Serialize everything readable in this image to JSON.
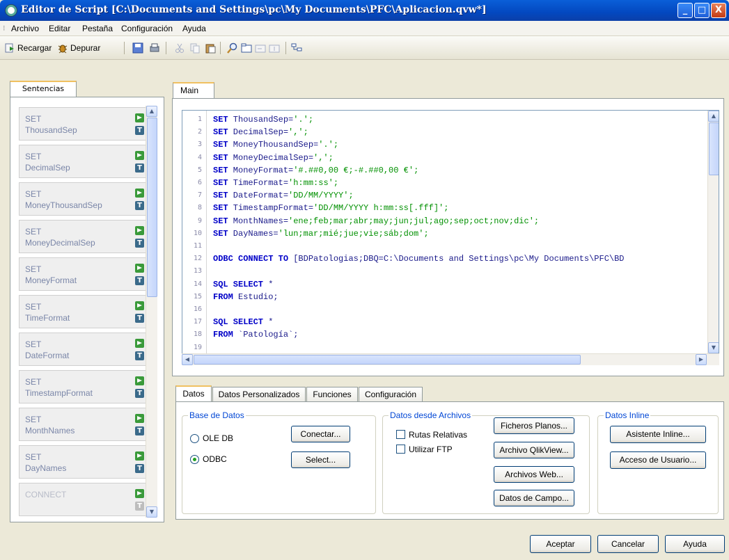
{
  "window": {
    "title": "Editor de Script [C:\\Documents and Settings\\pc\\My Documents\\PFC\\Aplicacion.qvw*]",
    "minimize": "_",
    "maximize": "□",
    "close": "X"
  },
  "menu": {
    "items": [
      {
        "label": "Archivo"
      },
      {
        "label": "Editar"
      },
      {
        "label": "Pestaña"
      },
      {
        "label": "Configuración"
      },
      {
        "label": "Ayuda"
      }
    ]
  },
  "toolbar": {
    "reload_label": "Recargar",
    "debug_label": "Depurar",
    "icons": [
      "reload-icon",
      "debug-icon",
      "save-icon",
      "print-icon",
      "cut-icon",
      "copy-icon",
      "paste-icon",
      "find-icon",
      "new-tab-icon",
      "insert-tab-icon",
      "promote-tab-icon",
      "script-icon"
    ]
  },
  "statements_panel": {
    "tab_label": "Sentencias",
    "items": [
      {
        "keyword": "SET",
        "name": "ThousandSep",
        "enabled": true
      },
      {
        "keyword": "SET",
        "name": "DecimalSep",
        "enabled": true
      },
      {
        "keyword": "SET",
        "name": "MoneyThousandSep",
        "enabled": true
      },
      {
        "keyword": "SET",
        "name": "MoneyDecimalSep",
        "enabled": true
      },
      {
        "keyword": "SET",
        "name": "MoneyFormat",
        "enabled": true
      },
      {
        "keyword": "SET",
        "name": "TimeFormat",
        "enabled": true
      },
      {
        "keyword": "SET",
        "name": "DateFormat",
        "enabled": true
      },
      {
        "keyword": "SET",
        "name": "TimestampFormat",
        "enabled": true
      },
      {
        "keyword": "SET",
        "name": "MonthNames",
        "enabled": true
      },
      {
        "keyword": "SET",
        "name": "DayNames",
        "enabled": true
      },
      {
        "keyword": "CONNECT",
        "name": "",
        "enabled": false
      }
    ],
    "t_glyph": "T"
  },
  "editor": {
    "tab_label": "Main",
    "lines": [
      {
        "n": "1",
        "kw": "SET",
        "rest": " ThousandSep=",
        "str": "'.';"
      },
      {
        "n": "2",
        "kw": "SET",
        "rest": " DecimalSep=",
        "str": "',';"
      },
      {
        "n": "3",
        "kw": "SET",
        "rest": " MoneyThousandSep=",
        "str": "'.';"
      },
      {
        "n": "4",
        "kw": "SET",
        "rest": " MoneyDecimalSep=",
        "str": "',';"
      },
      {
        "n": "5",
        "kw": "SET",
        "rest": " MoneyFormat=",
        "str": "'#.##0,00 €;-#.##0,00 €';"
      },
      {
        "n": "6",
        "kw": "SET",
        "rest": " TimeFormat=",
        "str": "'h:mm:ss';"
      },
      {
        "n": "7",
        "kw": "SET",
        "rest": " DateFormat=",
        "str": "'DD/MM/YYYY';"
      },
      {
        "n": "8",
        "kw": "SET",
        "rest": " TimestampFormat=",
        "str": "'DD/MM/YYYY h:mm:ss[.fff]';"
      },
      {
        "n": "9",
        "kw": "SET",
        "rest": " MonthNames=",
        "str": "'ene;feb;mar;abr;may;jun;jul;ago;sep;oct;nov;dic';"
      },
      {
        "n": "10",
        "kw": "SET",
        "rest": " DayNames=",
        "str": "'lun;mar;mié;jue;vie;sáb;dom';"
      },
      {
        "n": "11",
        "kw": "",
        "rest": "",
        "str": ""
      },
      {
        "n": "12",
        "kw": "ODBC CONNECT TO",
        "rest": " [BDPatologias;DBQ=C:\\Documents and Settings\\pc\\My Documents\\PFC\\BD",
        "str": ""
      },
      {
        "n": "13",
        "kw": "",
        "rest": "",
        "str": ""
      },
      {
        "n": "14",
        "kw": "SQL SELECT",
        "rest": " *",
        "str": ""
      },
      {
        "n": "15",
        "kw": "FROM",
        "rest": " Estudio;",
        "str": ""
      },
      {
        "n": "16",
        "kw": "",
        "rest": "",
        "str": ""
      },
      {
        "n": "17",
        "kw": "SQL SELECT",
        "rest": " *",
        "str": ""
      },
      {
        "n": "18",
        "kw": "FROM",
        "rest": " `Patología`;",
        "str": ""
      },
      {
        "n": "19",
        "kw": "",
        "rest": "",
        "str": ""
      }
    ]
  },
  "bottom_tabs": [
    {
      "label": "Datos",
      "active": true
    },
    {
      "label": "Datos Personalizados",
      "active": false
    },
    {
      "label": "Funciones",
      "active": false
    },
    {
      "label": "Configuración",
      "active": false
    }
  ],
  "database_group": {
    "label": "Base de Datos",
    "ole_label": "OLE DB",
    "odbc_label": "ODBC",
    "selected": "ODBC",
    "connect_button": "Conectar...",
    "select_button": "Select..."
  },
  "files_group": {
    "label": "Datos desde Archivos",
    "relative_paths_label": "Rutas Relativas",
    "use_ftp_label": "Utilizar FTP",
    "flat_files_button": "Ficheros Planos...",
    "qlikview_file_button": "Archivo QlikView...",
    "web_files_button": "Archivos Web...",
    "field_data_button": "Datos de Campo..."
  },
  "inline_group": {
    "label": "Datos Inline",
    "wizard_button": "Asistente Inline...",
    "user_access_button": "Acceso de Usuario..."
  },
  "dialog_buttons": {
    "accept": "Aceptar",
    "cancel": "Cancelar",
    "help": "Ayuda"
  }
}
